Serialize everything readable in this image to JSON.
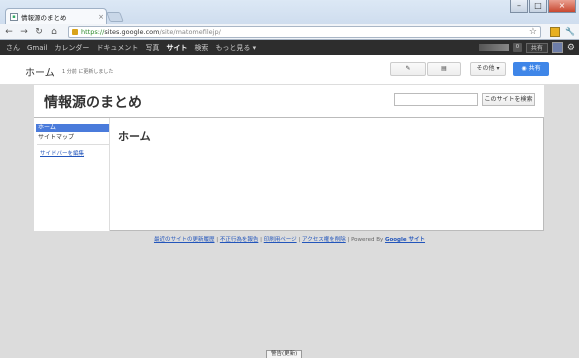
{
  "browser": {
    "tab_title": "情報源のまとめ",
    "url_scheme": "https://",
    "url_host": "sites.google.com",
    "url_path": "/site/matomefilejp/"
  },
  "gbar": {
    "items": [
      "さん",
      "Gmail",
      "カレンダー",
      "ドキュメント",
      "写真",
      "サイト",
      "検索",
      "もっと見る ▾"
    ],
    "selected": "サイト",
    "count": "0",
    "share": "共有"
  },
  "sitebar": {
    "title": "ホーム",
    "subtitle": "1 分前 に更新しました",
    "more_label": "その他 ▾",
    "share_label": "共有"
  },
  "site": {
    "title": "情報源のまとめ",
    "search_button": "このサイトを検索",
    "nav_home": "ホーム",
    "nav_sitemap": "サイトマップ",
    "edit_sidebar": "サイドバーを編集",
    "page_title": "ホーム"
  },
  "footer": {
    "recent": "最近のサイトの更新履歴",
    "report": "不正行為を報告",
    "print": "印刷用ページ",
    "access": "アクセス権を削除",
    "powered": "Powered By",
    "gs": "Google サイト"
  },
  "status": "警告(更新)"
}
